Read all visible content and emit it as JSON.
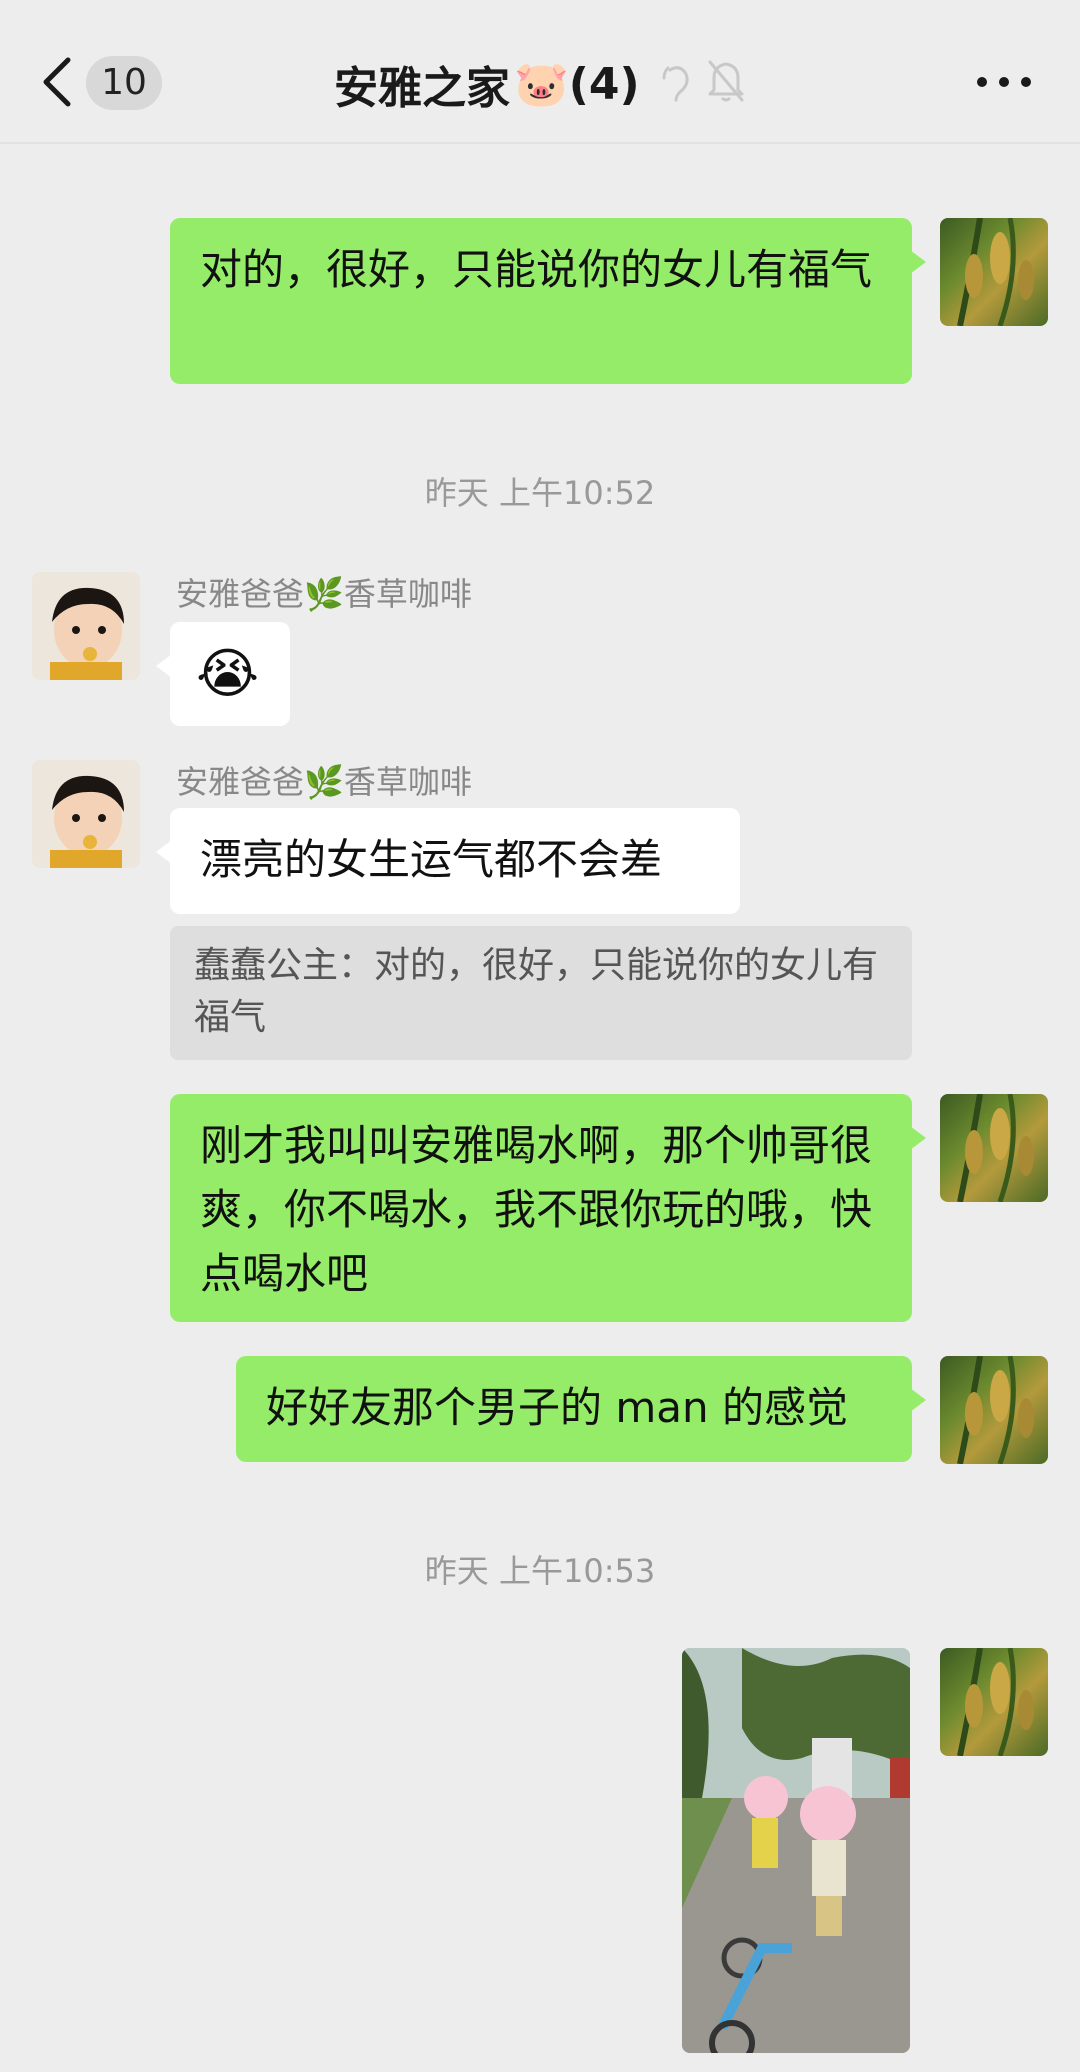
{
  "header": {
    "back_count": "10",
    "title": "安雅之家",
    "title_emoji": "🐷",
    "member_count": "(4)"
  },
  "messages": {
    "m1": {
      "text": "对的，很好，只能说你的女儿有福气"
    },
    "time1": "昨天 上午10:52",
    "m2": {
      "sender": "安雅爸爸🌿香草咖啡",
      "emoji": "😭"
    },
    "m3": {
      "sender": "安雅爸爸🌿香草咖啡",
      "text": "漂亮的女生运气都不会差",
      "quote": "蠢蠢公主：对的，很好，只能说你的女儿有福气"
    },
    "m4": {
      "text": "刚才我叫叫安雅喝水啊，那个帅哥很爽，你不喝水，我不跟你玩的哦，快点喝水吧"
    },
    "m5": {
      "text": "好好友那个男子的 man 的感觉"
    },
    "time2": "昨天 上午10:53"
  },
  "colors": {
    "background": "#ededed",
    "self_bubble": "#95ec69",
    "other_bubble": "#ffffff",
    "quote_bg": "#dedede"
  }
}
